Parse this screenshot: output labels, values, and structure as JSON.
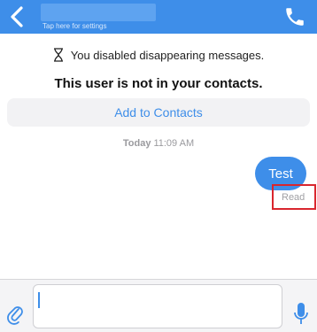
{
  "header": {
    "subtitle": "Tap here for settings",
    "back_icon": "chevron-left-icon",
    "call_icon": "phone-icon",
    "color": "#3e8ee9"
  },
  "system_message": {
    "icon": "hourglass-icon",
    "text": "You disabled disappearing messages."
  },
  "contact_notice": {
    "text": "This user is not in your contacts.",
    "action_label": "Add to Contacts"
  },
  "conversation": {
    "day": "Today",
    "time": "11:09 AM",
    "messages": [
      {
        "direction": "outgoing",
        "text": "Test",
        "status": "Read"
      }
    ]
  },
  "composer": {
    "attach_icon": "paperclip-icon",
    "mic_icon": "microphone-icon",
    "value": ""
  },
  "colors": {
    "accent": "#3e8ee9",
    "highlight": "#d9262e"
  }
}
